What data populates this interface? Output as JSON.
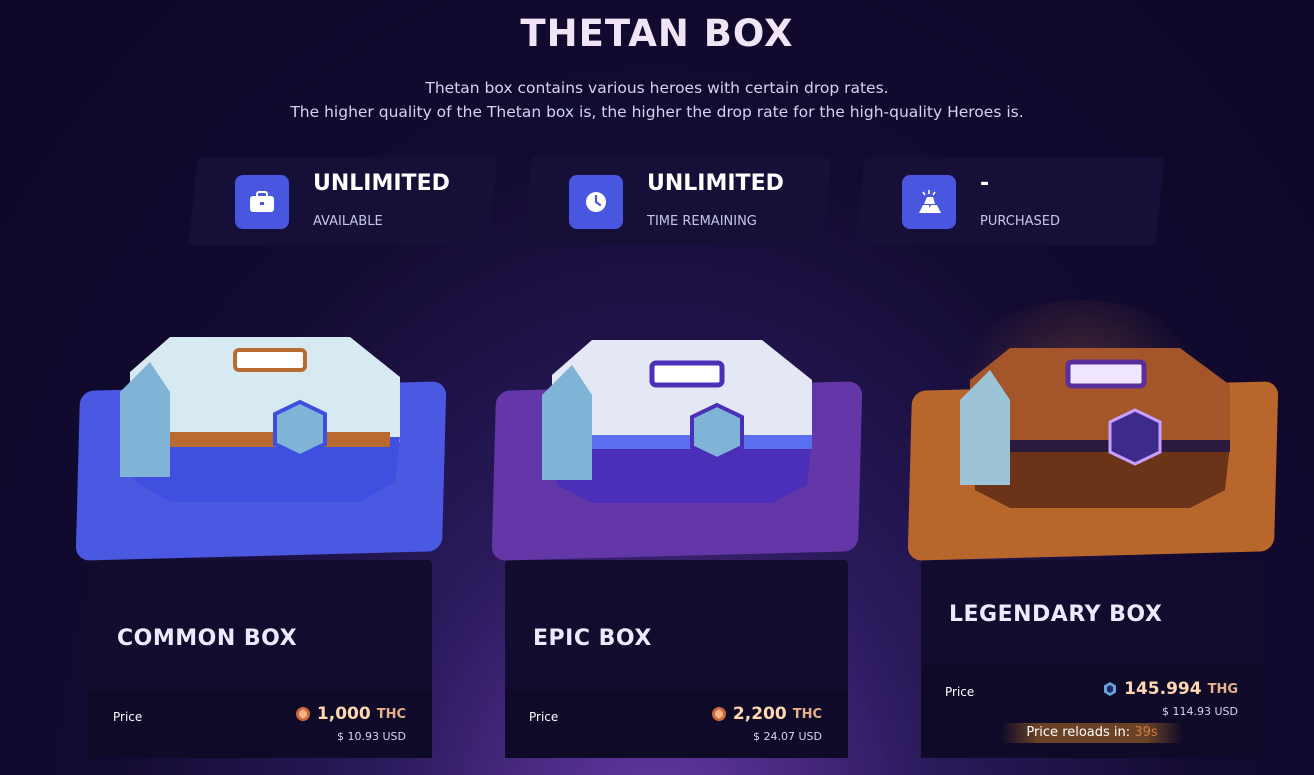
{
  "header": {
    "title": "THETAN BOX",
    "desc_line1": "Thetan box contains various heroes with certain drop rates.",
    "desc_line2": "The higher quality of the Thetan box is, the higher the drop rate for the high-quality Heroes is."
  },
  "stats": [
    {
      "value": "UNLIMITED",
      "label": "AVAILABLE",
      "icon": "briefcase-icon"
    },
    {
      "value": "UNLIMITED",
      "label": "TIME REMAINING",
      "icon": "clock-icon"
    },
    {
      "value": "-",
      "label": "PURCHASED",
      "icon": "gold-bars-icon"
    }
  ],
  "boxes": [
    {
      "name": "COMMON BOX",
      "price_label": "Price",
      "amount": "1,000",
      "unit": "THC",
      "usd": "$ 10.93 USD",
      "color": "#4a58e2"
    },
    {
      "name": "EPIC BOX",
      "price_label": "Price",
      "amount": "2,200",
      "unit": "THC",
      "usd": "$ 24.07 USD",
      "color": "#6437a8"
    },
    {
      "name": "LEGENDARY BOX",
      "price_label": "Price",
      "amount": "145.994",
      "unit": "THG",
      "usd": "$ 114.93 USD",
      "color": "#b9662c",
      "reload_label": "Price reloads in:",
      "reload_seconds": "39s"
    }
  ]
}
